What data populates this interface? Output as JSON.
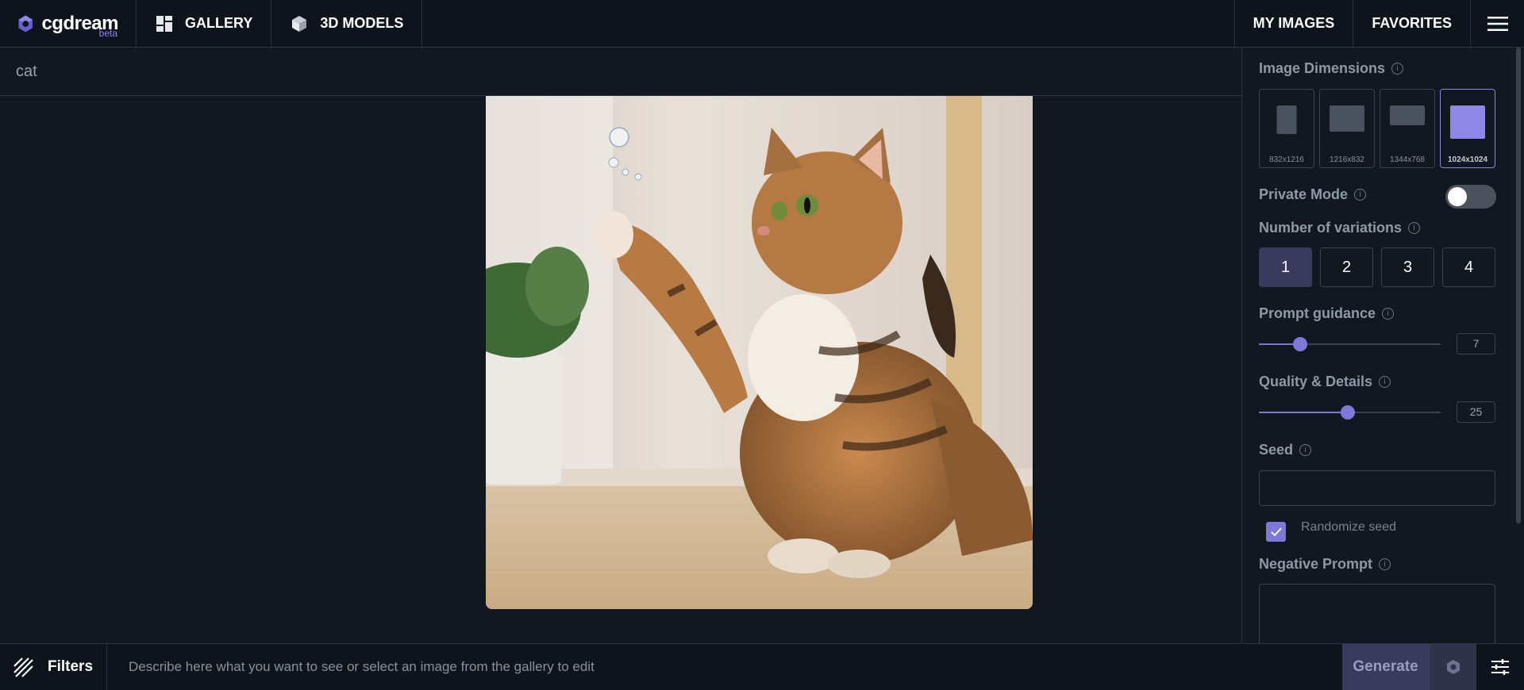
{
  "app": {
    "logo_text": "cgdream",
    "logo_badge": "beta"
  },
  "nav": {
    "gallery": "GALLERY",
    "models": "3D MODELS",
    "my_images": "MY IMAGES",
    "favorites": "FAVORITES"
  },
  "prompt": {
    "text": "cat"
  },
  "panel": {
    "dimensions_label": "Image Dimensions",
    "dimensions": [
      {
        "label": "832x1216",
        "selected": false
      },
      {
        "label": "1216x832",
        "selected": false
      },
      {
        "label": "1344x768",
        "selected": false
      },
      {
        "label": "1024x1024",
        "selected": true
      }
    ],
    "private_mode_label": "Private Mode",
    "private_mode_on": false,
    "variations_label": "Number of variations",
    "variations": [
      "1",
      "2",
      "3",
      "4"
    ],
    "variations_selected": "1",
    "prompt_guidance_label": "Prompt guidance",
    "prompt_guidance_value": "7",
    "quality_label": "Quality & Details",
    "quality_value": "25",
    "seed_label": "Seed",
    "randomize_seed_label": "Randomize seed",
    "randomize_seed_checked": true,
    "negative_prompt_label": "Negative Prompt"
  },
  "bottom": {
    "filters_label": "Filters",
    "describe_placeholder": "Describe here what you want to see or select an image from the gallery to edit",
    "generate_label": "Generate"
  },
  "colors": {
    "accent": "#7f78d8",
    "background": "#111820",
    "bar": "#0e141b"
  }
}
